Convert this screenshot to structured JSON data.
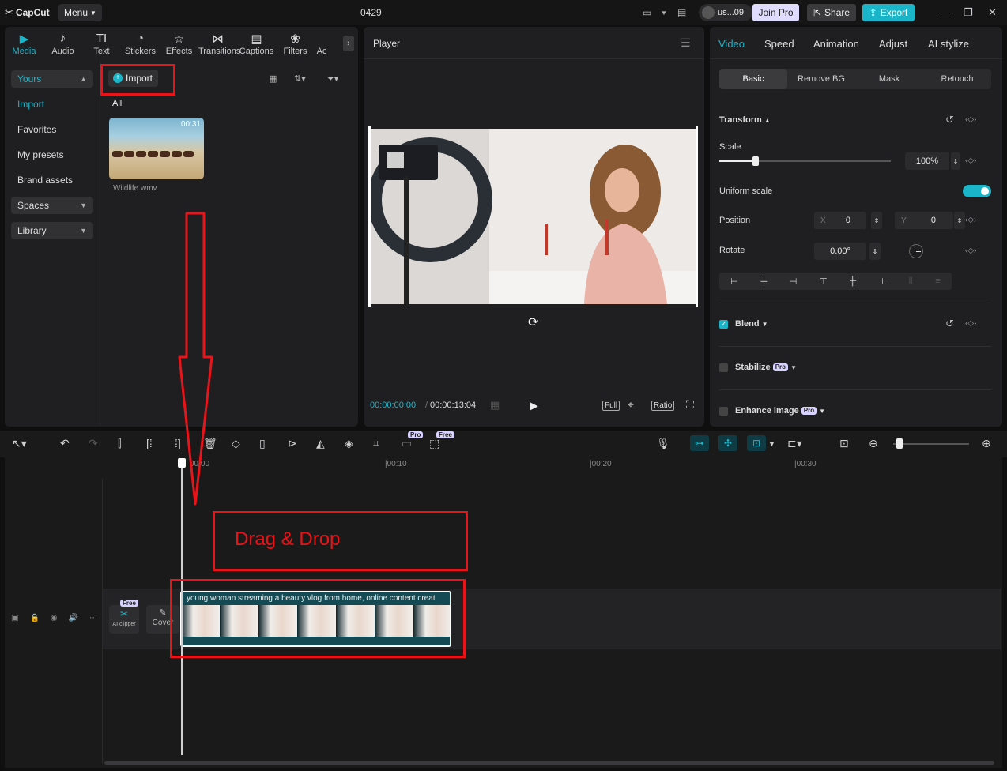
{
  "app": {
    "logo": "CapCut",
    "menu": "Menu",
    "project_title": "0429",
    "user": "us...09",
    "join_pro": "Join Pro",
    "share": "Share",
    "export": "Export"
  },
  "colors": {
    "accent": "#1bb5c9",
    "annotation_red": "#e8141a",
    "pro_badge": "#d8d2ff"
  },
  "media_tabs": [
    {
      "label": "Media",
      "icon": "media-icon"
    },
    {
      "label": "Audio",
      "icon": "audio-icon"
    },
    {
      "label": "Text",
      "icon": "text-icon"
    },
    {
      "label": "Stickers",
      "icon": "stickers-icon"
    },
    {
      "label": "Effects",
      "icon": "effects-icon"
    },
    {
      "label": "Transitions",
      "icon": "transitions-icon"
    },
    {
      "label": "Captions",
      "icon": "captions-icon"
    },
    {
      "label": "Filters",
      "icon": "filters-icon"
    },
    {
      "label": "Ac",
      "icon": "adjust-icon"
    }
  ],
  "sidebar": {
    "yours": "Yours",
    "import": "Import",
    "favorites": "Favorites",
    "my_presets": "My presets",
    "brand_assets": "Brand assets",
    "spaces": "Spaces",
    "library": "Library"
  },
  "media": {
    "import_button": "Import",
    "filter_all": "All",
    "file_name": "Wildlife.wmv",
    "file_duration": "00:31"
  },
  "player": {
    "title": "Player",
    "current_time": "00:00:00:00",
    "total_time": "00:00:13:04",
    "full": "Full",
    "ratio": "Ratio"
  },
  "props": {
    "tabs": [
      "Video",
      "Speed",
      "Animation",
      "Adjust",
      "AI stylize"
    ],
    "subtabs": [
      "Basic",
      "Remove BG",
      "Mask",
      "Retouch"
    ],
    "transform": "Transform",
    "scale_label": "Scale",
    "scale_value": "100%",
    "scale_fraction": 0.2,
    "uniform_scale": "Uniform scale",
    "position_label": "Position",
    "x_label": "X",
    "x_value": "0",
    "y_label": "Y",
    "y_value": "0",
    "rotate_label": "Rotate",
    "rotate_value": "0.00°",
    "blend": "Blend",
    "stabilize": "Stabilize",
    "enhance_image": "Enhance image",
    "pro": "Pro"
  },
  "toolbar": {
    "pro": "Pro",
    "free": "Free"
  },
  "timeline": {
    "ruler": [
      "00:00",
      "|00:10",
      "|00:20",
      "|00:30"
    ],
    "ai_clipper": "AI clipper",
    "ai_free": "Free",
    "cover": "Cover",
    "clip_title": "young woman streaming a beauty vlog from home, online content creat"
  },
  "annotation": {
    "drag_drop": "Drag & Drop"
  }
}
